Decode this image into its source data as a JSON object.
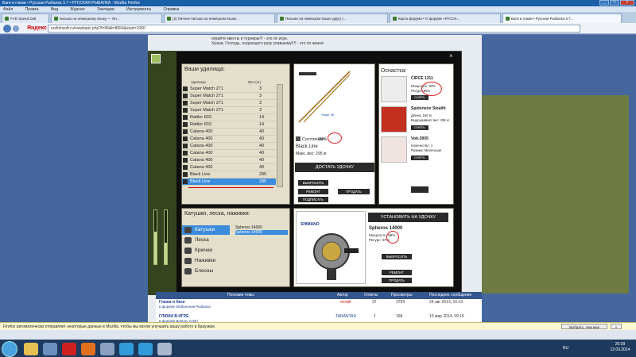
{
  "window": {
    "title": "Баги и глюки • Русская Рыбалка 3.7 • РУССКАЯ РЫБАЛКА - Mozilla Firefox"
  },
  "menu": [
    "Файл",
    "Правка",
    "Вид",
    "Журнал",
    "Закладки",
    "Инструменты",
    "Справка"
  ],
  "tabs": [
    "FVD Speed Dial",
    "письмо на немецкому языку — Ян...",
    "(2) Личное письмо на немецком языке...",
    "Письмо на немецком языке другу |...",
    "Карта форума • О форуме «РУССК...",
    "Баги и глюки • Русская Рыбалка 3.7..."
  ],
  "nav": {
    "search_brand": "Яндекс",
    "url": "rusfishsoft.ru/viewtopic.php?f=96&t=8654&start=1060"
  },
  "forum_lines": [
    "играйте квесты и турниры!!! - это по игре.",
    "Храни, Господь, подающего руку упавшему!!!! - это по жизни."
  ],
  "rods": {
    "title": "Ваши удилища:",
    "col_name": "Удилище",
    "col_weight": "Вес (кг)",
    "items": [
      {
        "name": "Super Match 271",
        "weight": "3"
      },
      {
        "name": "Super Match 271",
        "weight": "3"
      },
      {
        "name": "Super Match 271",
        "weight": "3"
      },
      {
        "name": "Super Match 271",
        "weight": "3"
      },
      {
        "name": "Rattler 833",
        "weight": "14"
      },
      {
        "name": "Rattler 833",
        "weight": "14"
      },
      {
        "name": "Catana 400",
        "weight": "40"
      },
      {
        "name": "Catana 400",
        "weight": "40"
      },
      {
        "name": "Catana 400",
        "weight": "40"
      },
      {
        "name": "Catana 400",
        "weight": "40"
      },
      {
        "name": "Catana 400",
        "weight": "40"
      },
      {
        "name": "Catana 400",
        "weight": "40"
      },
      {
        "name": "Black Line",
        "weight": "295"
      },
      {
        "name": "Black Line",
        "weight": "295"
      }
    ],
    "selected_index": 13
  },
  "rod_detail": {
    "condition_label": "Состояние:",
    "condition_value": "98%",
    "name": "Black Line",
    "max_weight": "Макс. вес: 295 кг",
    "attach_button": "ДОСТАТЬ УДОЧКУ",
    "buttons": [
      "ВЫБРОСИТЬ",
      "РЕМОНТ",
      "ПОДПИСАТЬ",
      "ПРОДАТЬ"
    ]
  },
  "tackle": {
    "title": "Оснастка:",
    "items": [
      {
        "name": "CIRCE 1311",
        "line1": "Мощность: 83%",
        "line2": "Ресурс: 95%",
        "button": "СНЯТЬ"
      },
      {
        "name": "Spiderwire Stealth",
        "line1": "Длина: 150 м",
        "line2": "Выдерживает вес: 295 кг",
        "button": "СНЯТЬ"
      },
      {
        "name": "Vob-3005",
        "line1": "Количество: 1",
        "line2": "Размер: Маленькая",
        "button": "СНЯТЬ"
      }
    ]
  },
  "reels": {
    "title": "Катушки, леска, наживки:",
    "categories": [
      "Катушки",
      "Леска",
      "Крючки",
      "Наживки",
      "Блесны"
    ],
    "selected_category": 0,
    "list": [
      "Spheros 14000",
      "Spheros 14000"
    ]
  },
  "reel_detail": {
    "brand": "SHIMANO",
    "install_button": "УСТАНОВИТЬ НА УДОЧКУ",
    "name": "Spheros 14000",
    "power": "Мощность: 98%",
    "resource": "Ресурс: 97%",
    "buttons": [
      "ВЫБРОСИТЬ",
      "РЕМОНТ",
      "ПРОДАТЬ"
    ]
  },
  "forum_table": {
    "headers": [
      "Похожие темы",
      "Автор",
      "Ответы",
      "Просмотры",
      "Последнее сообщение"
    ],
    "rows": [
      {
        "title": "Глюки и баги",
        "sub": "в форуме Мобильная Рыбалка",
        "author": "motall",
        "replies": "37",
        "views": "3759",
        "last": "24 авг 2013, 16:13"
      },
      {
        "title": "ГЛЮКИ В ИГРЕ",
        "sub": "в форуме Вопрос-ответ",
        "author": "TARANTAS",
        "replies": "1",
        "views": "168",
        "last": "10 мар 2014, 09:16"
      }
    ]
  },
  "notification": {
    "text": "Firefox автоматически отправляет некоторые данные в Mozilla, чтобы мы могли улучшить вашу работу в браузере.",
    "button": "Выбрать, чем мне поделиться",
    "close": "×"
  },
  "taskbar": {
    "lang": "RU",
    "time": "20:39",
    "date": "12.03.2014"
  },
  "colors": {
    "accent": "#3c8cdd",
    "panel": "#e3dfcb",
    "highlight_red": "#dd2222"
  }
}
